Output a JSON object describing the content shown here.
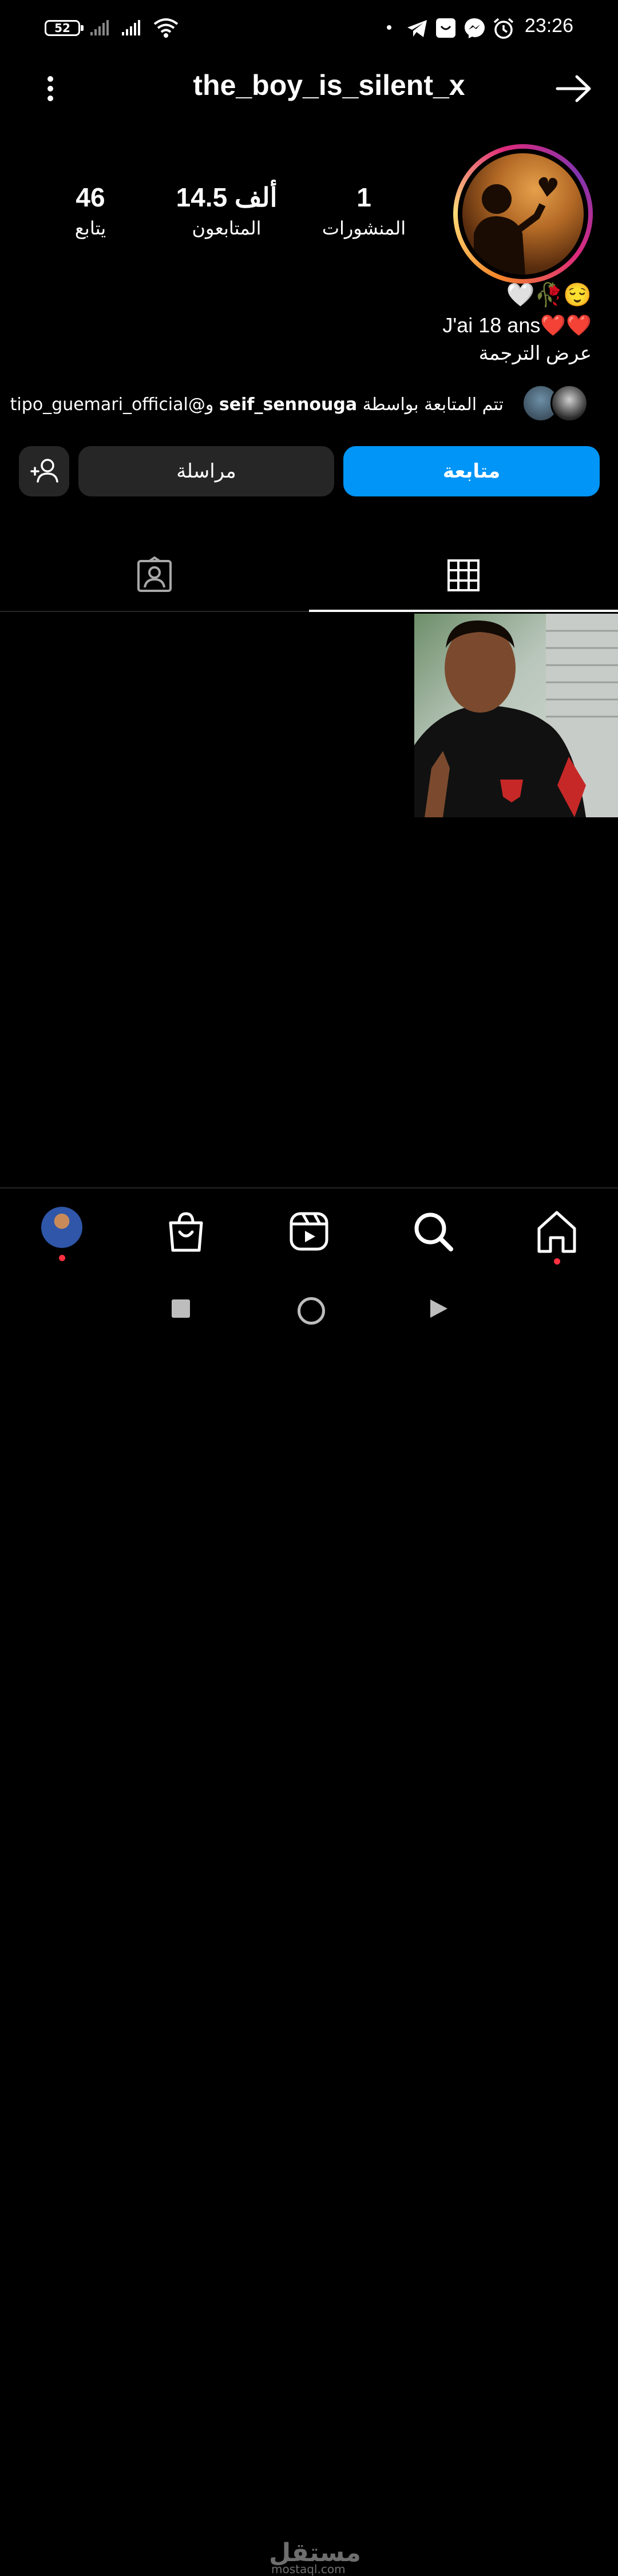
{
  "status_bar": {
    "battery": "52",
    "time": "23:26"
  },
  "header": {
    "username": "the_boy_is_silent_x"
  },
  "profile": {
    "stats": [
      {
        "value": "1",
        "label": "المنشورات"
      },
      {
        "value": "14.5 ألف",
        "label": "المتابعون"
      },
      {
        "value": "46",
        "label": "يتابع"
      }
    ],
    "bio_emojis": "🤍🥀😌",
    "bio_text": "J'ai 18 ans❤️❤️",
    "see_translation": "عرض الترجمة",
    "followed_by_prefix": "تتم المتابعة بواسطة",
    "followed_by_user1": "seif_sennouga",
    "followed_by_joiner": "و@",
    "followed_by_user2": "tipo_guemari_official"
  },
  "actions": {
    "follow": "متابعة",
    "message": "مراسلة"
  },
  "tabs": [
    {
      "name": "posts-grid",
      "active": true
    },
    {
      "name": "tagged",
      "active": false
    }
  ],
  "colors": {
    "accent": "#0095f6",
    "button_dark": "#262626",
    "notification_dot": "#ff3040"
  },
  "watermark": {
    "main": "مستقل",
    "sub": "mostaql.com"
  }
}
